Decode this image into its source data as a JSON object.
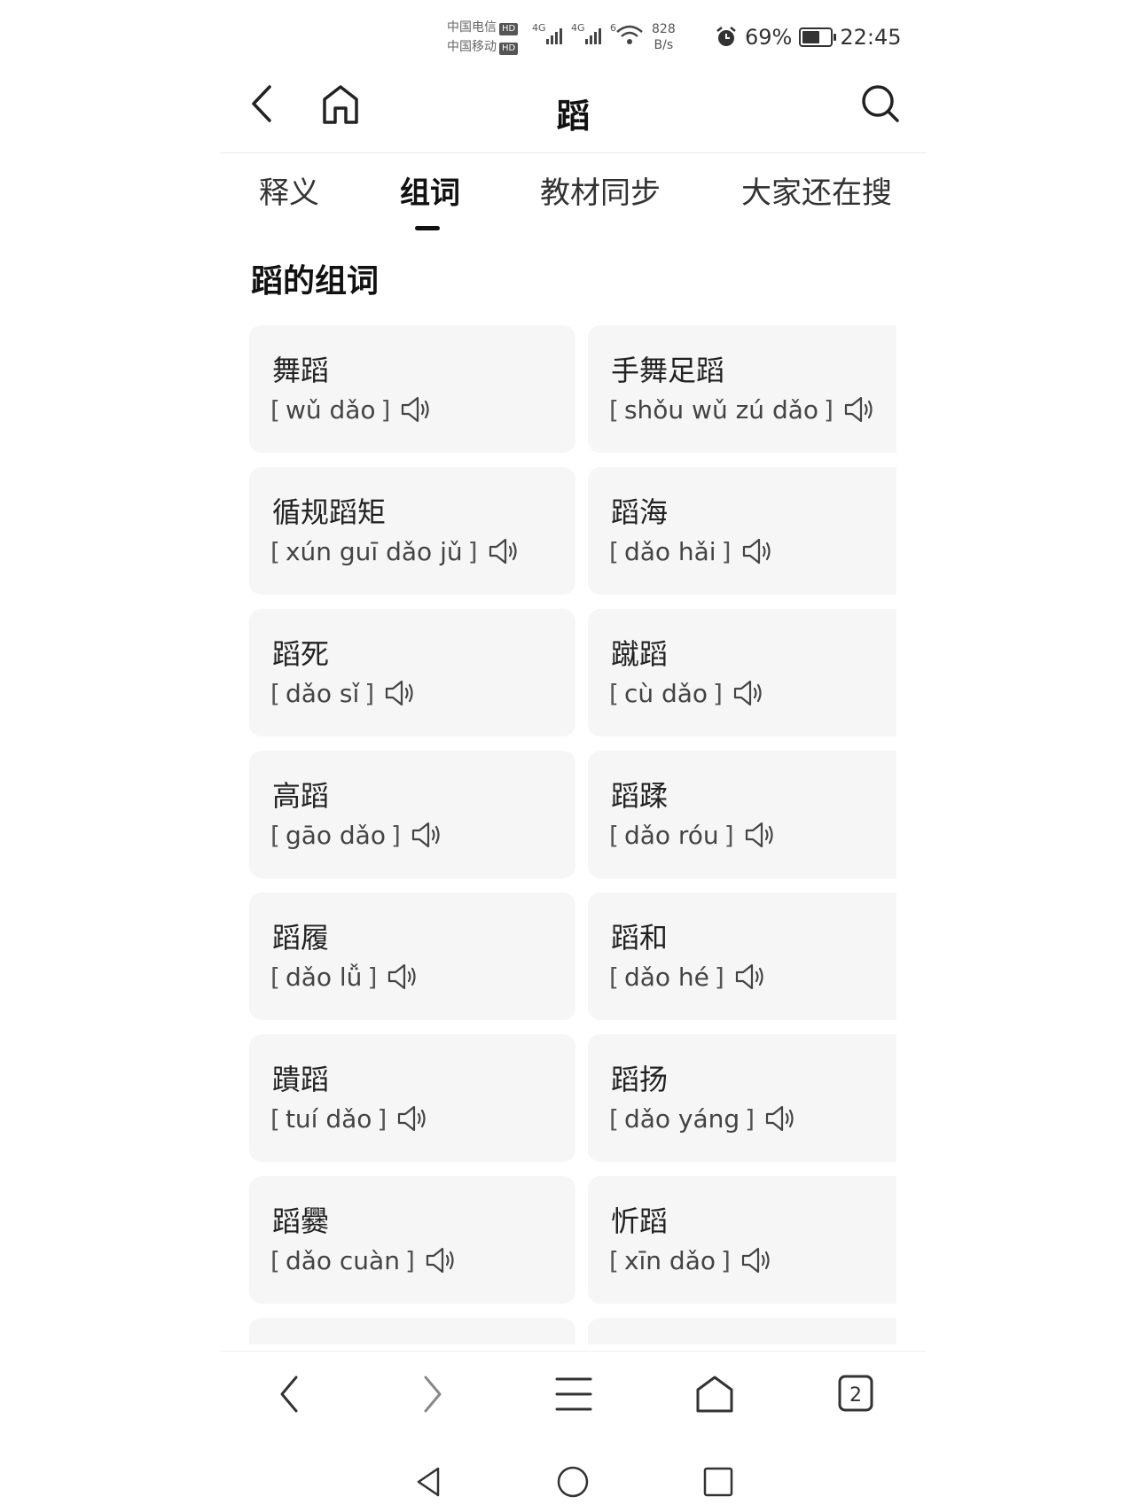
{
  "status_bar": {
    "carrier1": "中国电信",
    "carrier2": "中国移动",
    "hd": "HD",
    "net1": "4G",
    "net2": "4G",
    "wifi": "6",
    "speed_value": "828",
    "speed_unit": "B/s",
    "battery": "69%",
    "battery_level": 0.69,
    "time": "22:45"
  },
  "header": {
    "title": "蹈",
    "back_icon": "back-arrow-icon",
    "home_icon": "home-icon",
    "search_icon": "search-icon"
  },
  "tabs": [
    {
      "label": "释义",
      "active": false
    },
    {
      "label": "组词",
      "active": true
    },
    {
      "label": "教材同步",
      "active": false
    },
    {
      "label": "大家还在搜",
      "active": false
    }
  ],
  "section_title": "蹈的组词",
  "words": [
    {
      "word": "舞蹈",
      "pinyin": "wǔ dǎo"
    },
    {
      "word": "手舞足蹈",
      "pinyin": "shǒu wǔ zú dǎo"
    },
    {
      "word": "循规蹈矩",
      "pinyin": "xún guī dǎo jǔ"
    },
    {
      "word": "蹈海",
      "pinyin": "dǎo hǎi"
    },
    {
      "word": "蹈死",
      "pinyin": "dǎo sǐ"
    },
    {
      "word": "蹴蹈",
      "pinyin": "cù dǎo"
    },
    {
      "word": "高蹈",
      "pinyin": "gāo dǎo"
    },
    {
      "word": "蹈蹂",
      "pinyin": "dǎo róu"
    },
    {
      "word": "蹈履",
      "pinyin": "dǎo lǚ"
    },
    {
      "word": "蹈和",
      "pinyin": "dǎo hé"
    },
    {
      "word": "蹪蹈",
      "pinyin": "tuí dǎo"
    },
    {
      "word": "蹈扬",
      "pinyin": "dǎo yáng"
    },
    {
      "word": "蹈爨",
      "pinyin": "dǎo cuàn"
    },
    {
      "word": "忻蹈",
      "pinyin": "xīn dǎo"
    }
  ],
  "bracket_open": "[",
  "bracket_close": "]",
  "bottom_bar": {
    "tab_count": "2",
    "icons": [
      "back-icon",
      "forward-icon",
      "menu-icon",
      "home-icon",
      "tabs-icon"
    ]
  },
  "system_nav": {
    "icons": [
      "nav-back-icon",
      "nav-home-icon",
      "nav-recents-icon"
    ]
  }
}
